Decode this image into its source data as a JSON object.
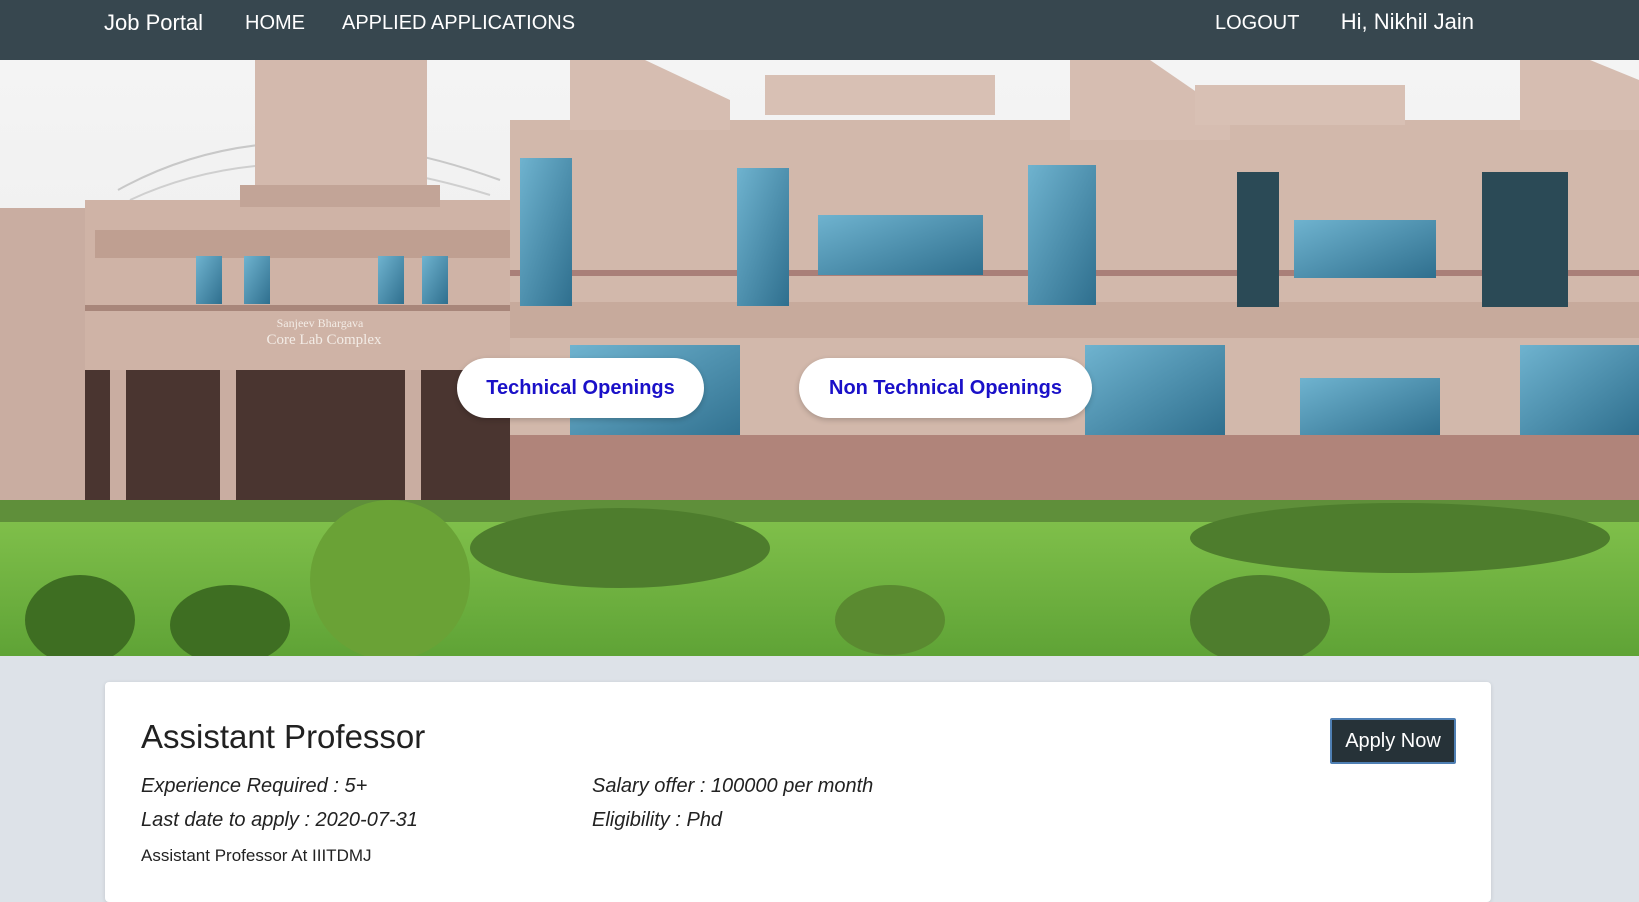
{
  "navbar": {
    "brand": "Job Portal",
    "home": "HOME",
    "applied": "APPLIED APPLICATIONS",
    "logout": "LOGOUT",
    "greeting": "Hi, Nikhil Jain"
  },
  "hero": {
    "building_sign_line1": "Sanjeev Bhargava",
    "building_sign_line2": "Core Lab Complex",
    "technical_button": "Technical Openings",
    "non_technical_button": "Non Technical Openings"
  },
  "job": {
    "title": "Assistant Professor",
    "experience": "Experience Required : 5+",
    "last_date": "Last date to apply : 2020-07-31",
    "salary": "Salary offer : 100000 per month",
    "eligibility": "Eligibility : Phd",
    "description": "Assistant Professor At IIITDMJ",
    "apply_label": "Apply Now"
  },
  "colors": {
    "navbar": "#37474f",
    "button_text": "#1a10c8",
    "apply_button": "#263238",
    "page_background": "#dde2e8"
  }
}
